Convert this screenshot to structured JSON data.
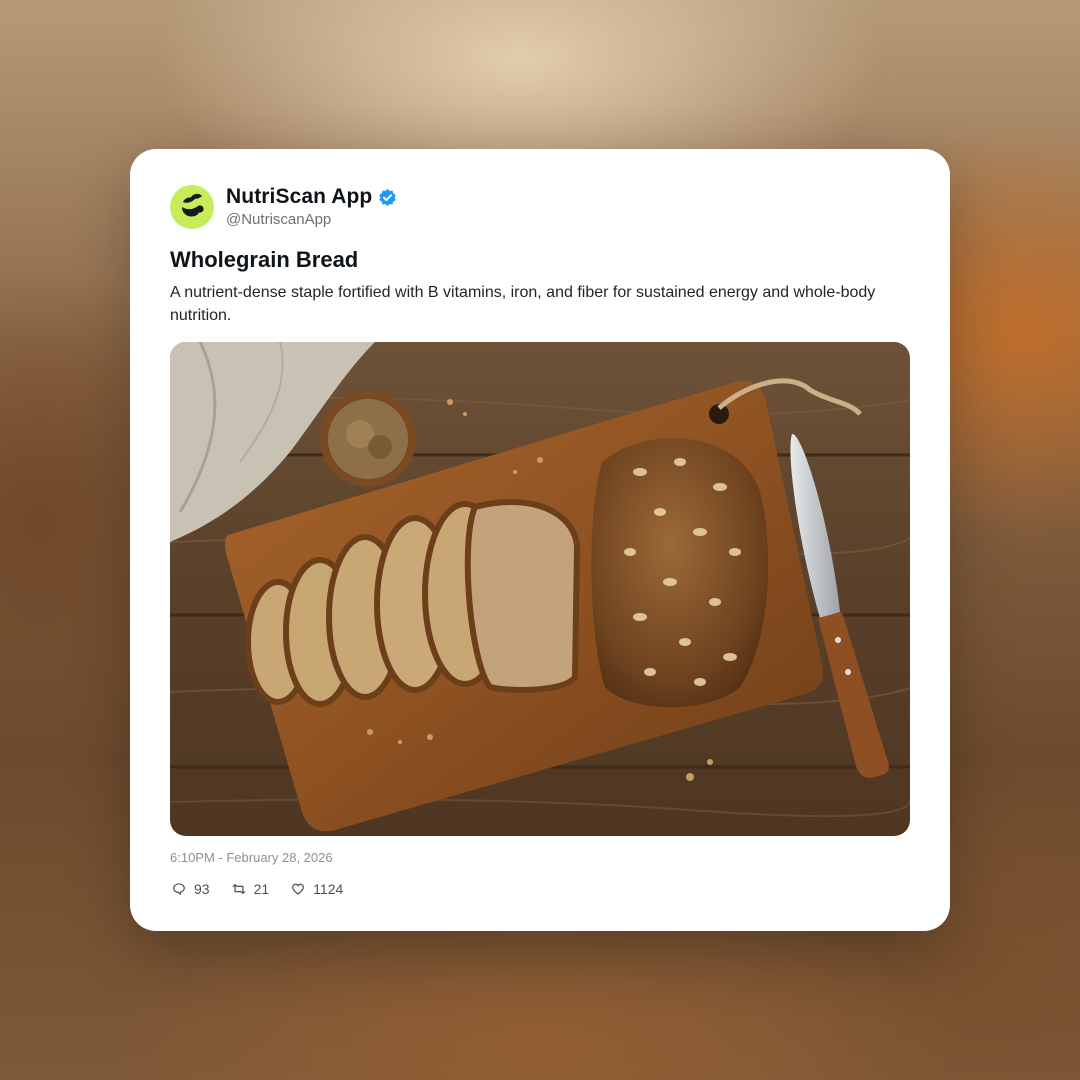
{
  "account": {
    "name": "NutriScan App",
    "handle": "@NutriscanApp",
    "avatar_icon": "leaf-logo-icon",
    "verified_icon": "verified-badge-icon",
    "avatar_color": "#c6ec5a",
    "verified_color": "#1d9bf0"
  },
  "post": {
    "title": "Wholegrain Bread",
    "description": "A nutrient-dense staple fortified with B vitamins, iron, and fiber for sustained energy and whole-body nutrition.",
    "timestamp": "6:10PM - February 28, 2026"
  },
  "stats": {
    "replies": "93",
    "retweets": "21",
    "likes": "1124",
    "reply_icon": "comment-bubble-icon",
    "retweet_icon": "retweet-icon",
    "like_icon": "heart-icon"
  }
}
